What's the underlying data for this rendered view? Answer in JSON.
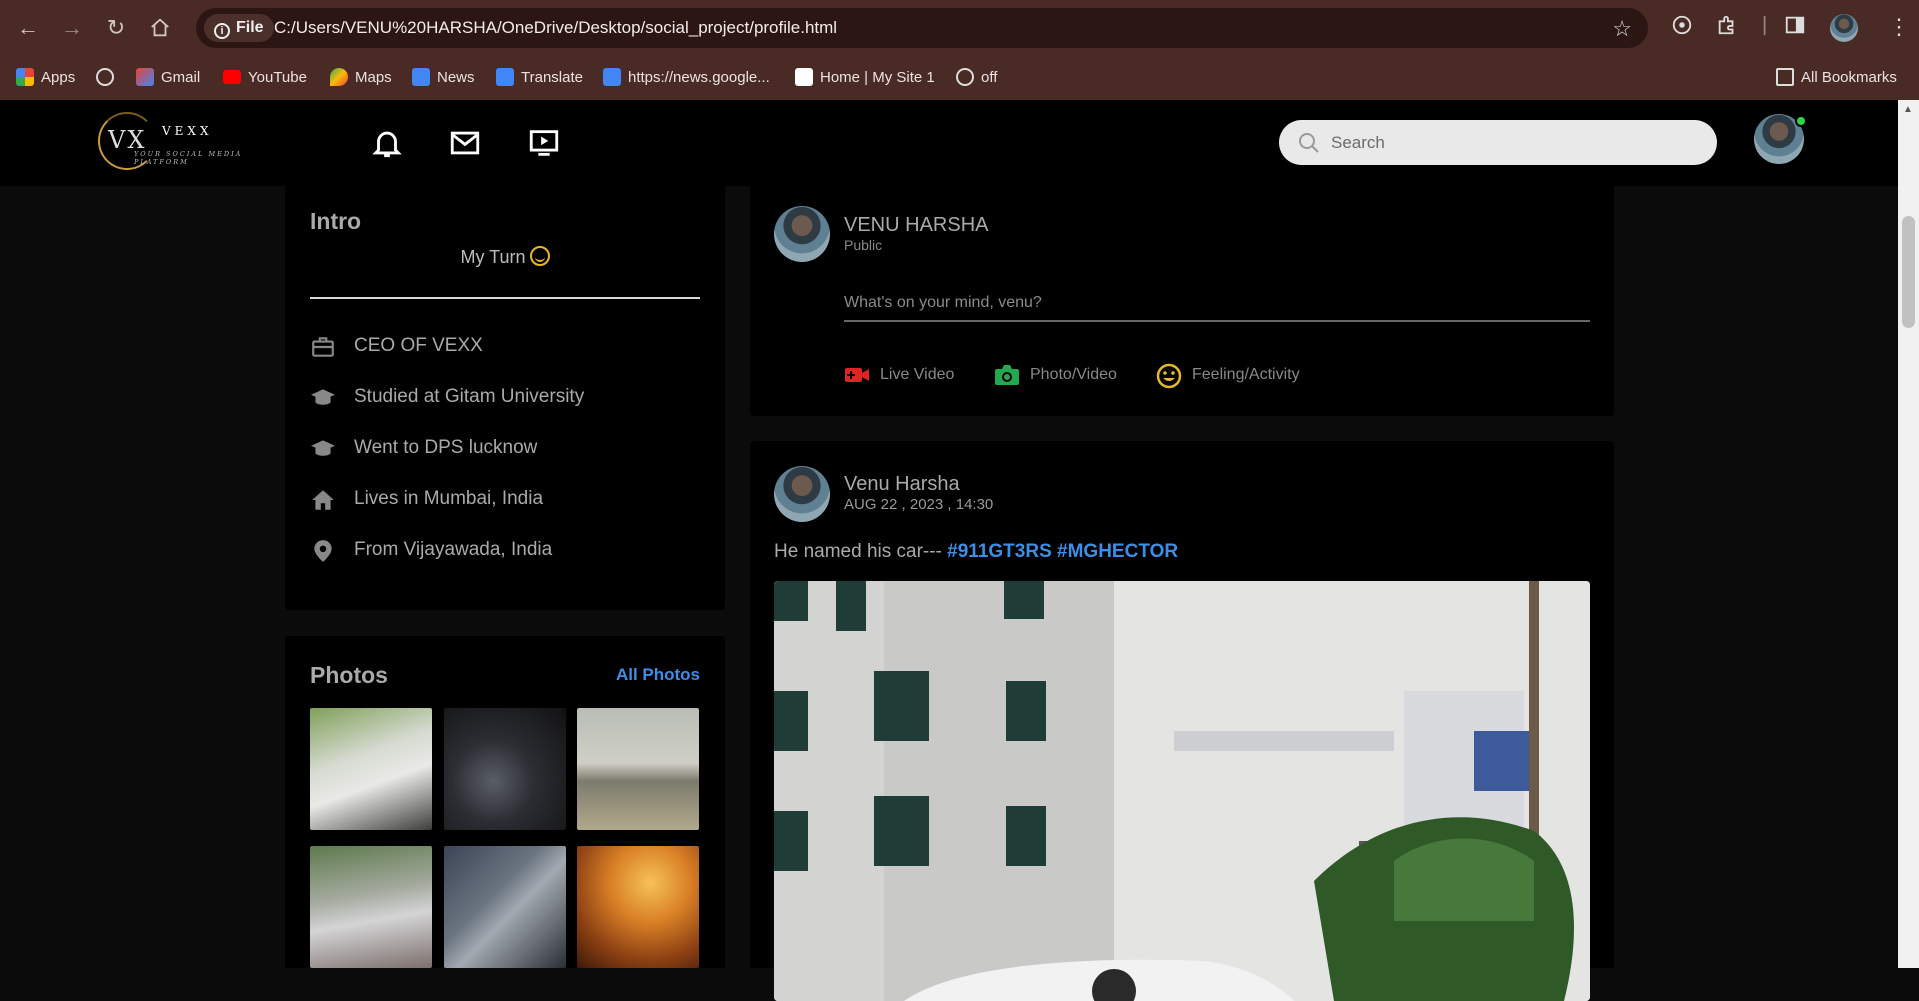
{
  "browser": {
    "url": "C:/Users/VENU%20HARSHA/OneDrive/Desktop/social_project/profile.html",
    "site_info_label": "File",
    "bookmarks": [
      {
        "label": "Apps",
        "icon": "apps-grid-icon"
      },
      {
        "label": "",
        "icon": "globe-icon"
      },
      {
        "label": "Gmail",
        "icon": "gmail-icon"
      },
      {
        "label": "YouTube",
        "icon": "youtube-icon"
      },
      {
        "label": "Maps",
        "icon": "maps-icon"
      },
      {
        "label": "News",
        "icon": "google-news-icon"
      },
      {
        "label": "Translate",
        "icon": "translate-icon"
      },
      {
        "label": "https://news.google...",
        "icon": "google-news-icon"
      },
      {
        "label": "Home | My Site 1",
        "icon": "wix-icon"
      },
      {
        "label": "off",
        "icon": "globe-icon"
      }
    ],
    "all_bookmarks_label": "All Bookmarks"
  },
  "header": {
    "logo_mark": "VX",
    "logo_name": "VEXX",
    "logo_tagline": "YOUR SOCIAL MEDIA PLATFORM",
    "search_placeholder": "Search"
  },
  "intro": {
    "title": "Intro",
    "bio": "My Turn",
    "items": [
      {
        "text": "CEO OF VEXX",
        "icon": "briefcase-icon"
      },
      {
        "text": "Studied at Gitam University",
        "icon": "graduation-cap-icon"
      },
      {
        "text": "Went to DPS lucknow",
        "icon": "graduation-cap-icon"
      },
      {
        "text": "Lives in Mumbai, India",
        "icon": "home-icon"
      },
      {
        "text": "From Vijayawada, India",
        "icon": "location-pin-icon"
      }
    ]
  },
  "photos": {
    "title": "Photos",
    "all_link": "All Photos"
  },
  "composer": {
    "name": "VENU HARSHA",
    "visibility": "Public",
    "placeholder": "What's on your mind, venu?",
    "actions": [
      {
        "label": "Live Video",
        "icon": "video-camera-icon",
        "color": "#e02424"
      },
      {
        "label": "Photo/Video",
        "icon": "camera-icon",
        "color": "#22a94f"
      },
      {
        "label": "Feeling/Activity",
        "icon": "smile-icon",
        "color": "#e8b826"
      }
    ]
  },
  "post": {
    "author": "Venu Harsha",
    "timestamp": "AUG 22 , 2023 , 14:30",
    "text": "He named his car---",
    "hashtags": [
      "#911GT3RS",
      "#MGHECTOR"
    ]
  },
  "colors": {
    "browser_chrome": "#4a2a25",
    "page_bg": "#0b0b0b",
    "accent": "#3b8fe8"
  }
}
